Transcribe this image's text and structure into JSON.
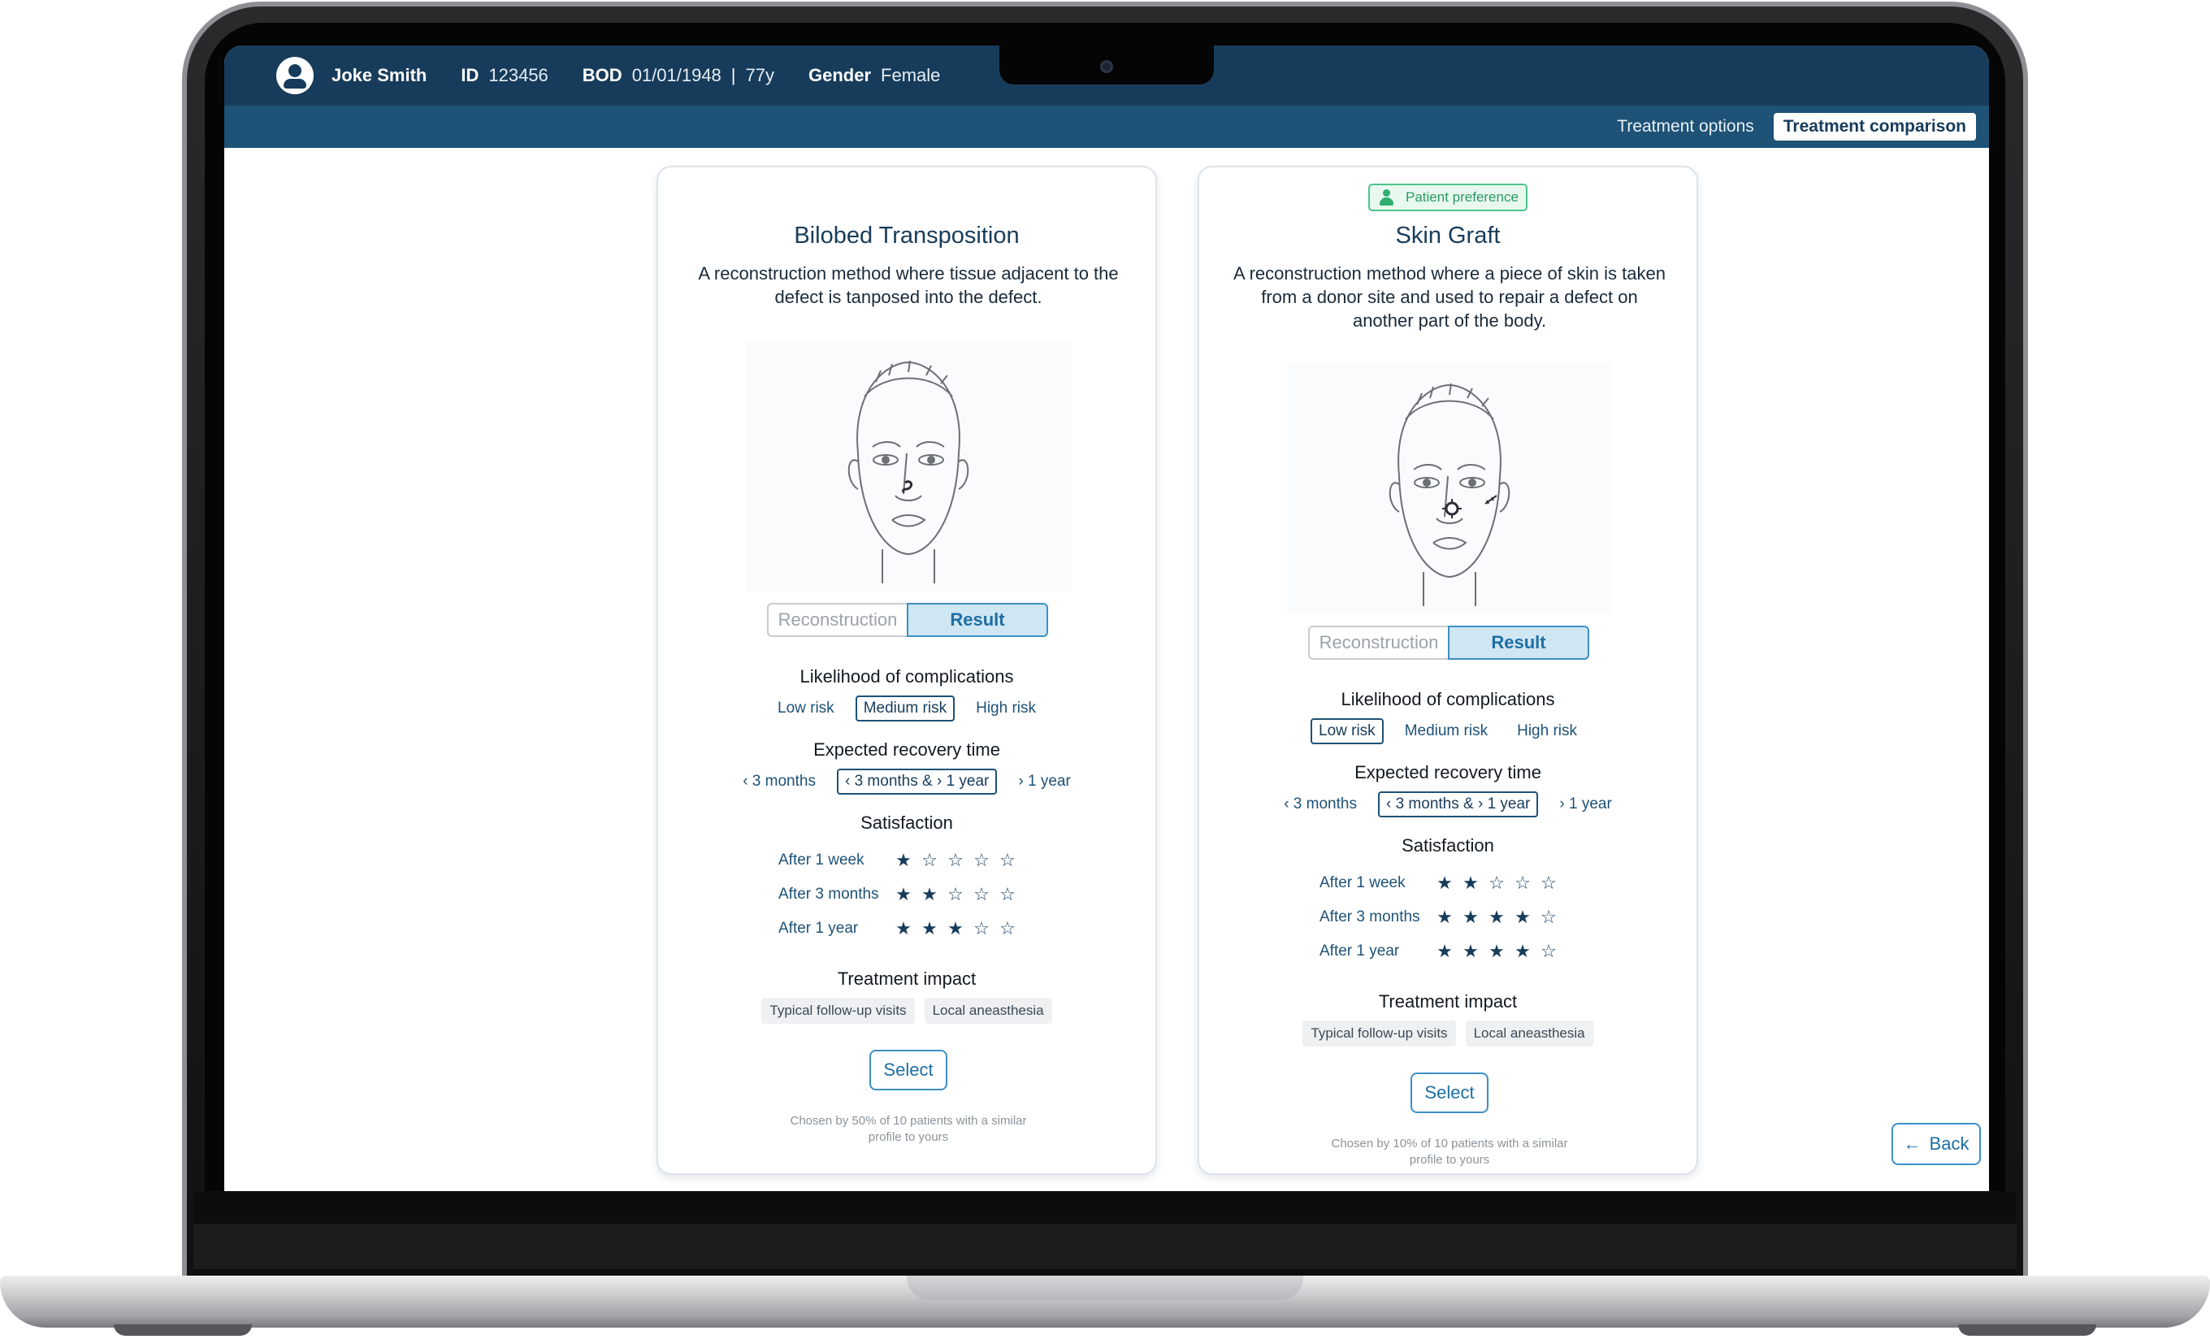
{
  "patient": {
    "name": "Joke Smith",
    "id_label": "ID",
    "id_value": "123456",
    "bod_label": "BOD",
    "bod_value": "01/01/1948",
    "separator": "|",
    "age": "77y",
    "gender_label": "Gender",
    "gender_value": "Female"
  },
  "tabs": [
    {
      "label": "Treatment options",
      "active": false
    },
    {
      "label": "Treatment comparison",
      "active": true
    }
  ],
  "cards": [
    {
      "title": "Bilobed Transposition",
      "description": "A reconstruction method where tissue adjacent to the defect is tanposed into the defect.",
      "patient_preference": false,
      "toggle": {
        "left": "Reconstruction",
        "right": "Result",
        "active": "Result"
      },
      "complications": {
        "heading": "Likelihood of complications",
        "options": [
          "Low risk",
          "Medium risk",
          "High risk"
        ],
        "selected": 1
      },
      "recovery": {
        "heading": "Expected recovery time",
        "options": [
          "‹ 3 months",
          "‹ 3 months & › 1 year",
          "› 1 year"
        ],
        "selected": 1
      },
      "satisfaction": {
        "heading": "Satisfaction",
        "rows": [
          {
            "label": "After 1 week",
            "stars": 1,
            "max": 5
          },
          {
            "label": "After 3 months",
            "stars": 2,
            "max": 5
          },
          {
            "label": "After 1 year",
            "stars": 3,
            "max": 5
          }
        ]
      },
      "impact": {
        "heading": "Treatment impact",
        "chips": [
          "Typical follow-up visits",
          "Local aneasthesia"
        ]
      },
      "select_label": "Select",
      "footnote": "Chosen by 50% of 10 patients with a similar profile to yours"
    },
    {
      "title": "Skin Graft",
      "description": "A reconstruction method where a piece of skin is taken from a donor site and used to repair a defect on another part of the body.",
      "patient_preference": true,
      "preference_label": "Patient preference",
      "toggle": {
        "left": "Reconstruction",
        "right": "Result",
        "active": "Result"
      },
      "complications": {
        "heading": "Likelihood of complications",
        "options": [
          "Low risk",
          "Medium risk",
          "High risk"
        ],
        "selected": 0
      },
      "recovery": {
        "heading": "Expected recovery time",
        "options": [
          "‹ 3 months",
          "‹ 3 months & › 1 year",
          "› 1 year"
        ],
        "selected": 1
      },
      "satisfaction": {
        "heading": "Satisfaction",
        "rows": [
          {
            "label": "After 1 week",
            "stars": 2,
            "max": 5
          },
          {
            "label": "After 3 months",
            "stars": 4,
            "max": 5
          },
          {
            "label": "After 1 year",
            "stars": 4,
            "max": 5
          }
        ]
      },
      "impact": {
        "heading": "Treatment impact",
        "chips": [
          "Typical follow-up visits",
          "Local aneasthesia"
        ]
      },
      "select_label": "Select",
      "footnote": "Chosen by 10% of 10 patients with a similar profile to yours"
    }
  ],
  "back_label": "Back",
  "icons": {
    "avatar": "user-circle-icon",
    "preference": "person-icon",
    "back": "arrow-left-icon",
    "star_filled": "★",
    "star_empty": "☆"
  },
  "colors": {
    "header": "#173c5b",
    "subheader": "#1e5276",
    "accent": "#3d8fc4",
    "preference": "#4cc48a"
  }
}
